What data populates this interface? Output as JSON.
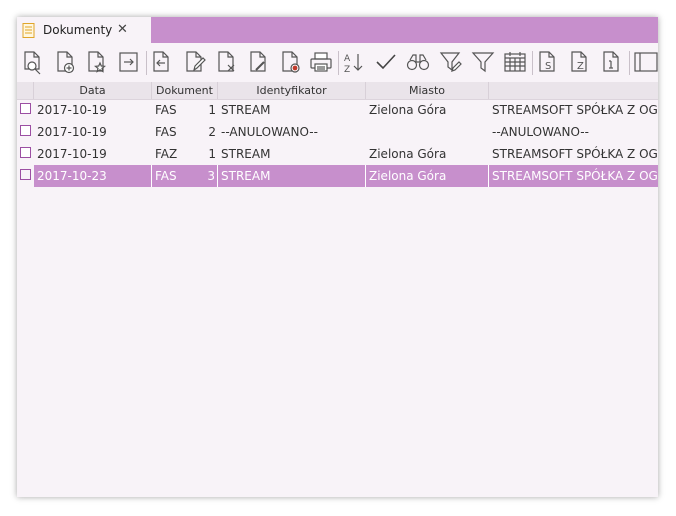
{
  "tab": {
    "title": "Dokumenty",
    "close_glyph": "✕",
    "icon": "document-list-icon"
  },
  "toolbar": {
    "buttons": [
      {
        "name": "preview-document-icon"
      },
      {
        "name": "add-document-icon"
      },
      {
        "name": "favorite-document-icon"
      },
      {
        "name": "export-document-icon"
      },
      {
        "name": "import-document-icon"
      },
      {
        "name": "edit-document-icon"
      },
      {
        "name": "delete-document-icon"
      },
      {
        "name": "annul-document-icon"
      },
      {
        "name": "record-document-icon"
      },
      {
        "name": "print-icon"
      },
      {
        "name": "sort-az-icon"
      },
      {
        "name": "checkmark-icon"
      },
      {
        "name": "binoculars-icon"
      },
      {
        "name": "filter-edit-icon"
      },
      {
        "name": "filter-icon"
      },
      {
        "name": "calendar-icon"
      },
      {
        "name": "document-s-icon"
      },
      {
        "name": "document-z-icon"
      },
      {
        "name": "document-info-icon"
      },
      {
        "name": "columns-icon"
      }
    ]
  },
  "table": {
    "columns": [
      "Data",
      "Dokument",
      "Identyfikator",
      "Miasto",
      ""
    ],
    "rows": [
      {
        "date": "2017-10-19",
        "doc": "FAS",
        "num": "1",
        "ident": "STREAM",
        "city": "Zielona Góra",
        "name": "STREAMSOFT SPÓŁKA Z OGRANICZONĄ",
        "selected": false
      },
      {
        "date": "2017-10-19",
        "doc": "FAS",
        "num": "2",
        "ident": "--ANULOWANO--",
        "city": "",
        "name": "--ANULOWANO--",
        "selected": false
      },
      {
        "date": "2017-10-19",
        "doc": "FAZ",
        "num": "1",
        "ident": "STREAM",
        "city": "Zielona Góra",
        "name": "STREAMSOFT SPÓŁKA Z OGRANICZONĄ",
        "selected": false
      },
      {
        "date": "2017-10-23",
        "doc": "FAS",
        "num": "3",
        "ident": "STREAM",
        "city": "Zielona Góra",
        "name": "STREAMSOFT SPÓŁKA Z OGRANICZONĄ",
        "selected": true
      }
    ]
  },
  "colors": {
    "accent": "#c78fcc",
    "background": "#f8f3f8",
    "checkbox_border": "#9c4fa3",
    "icon_red": "#c0392b"
  }
}
